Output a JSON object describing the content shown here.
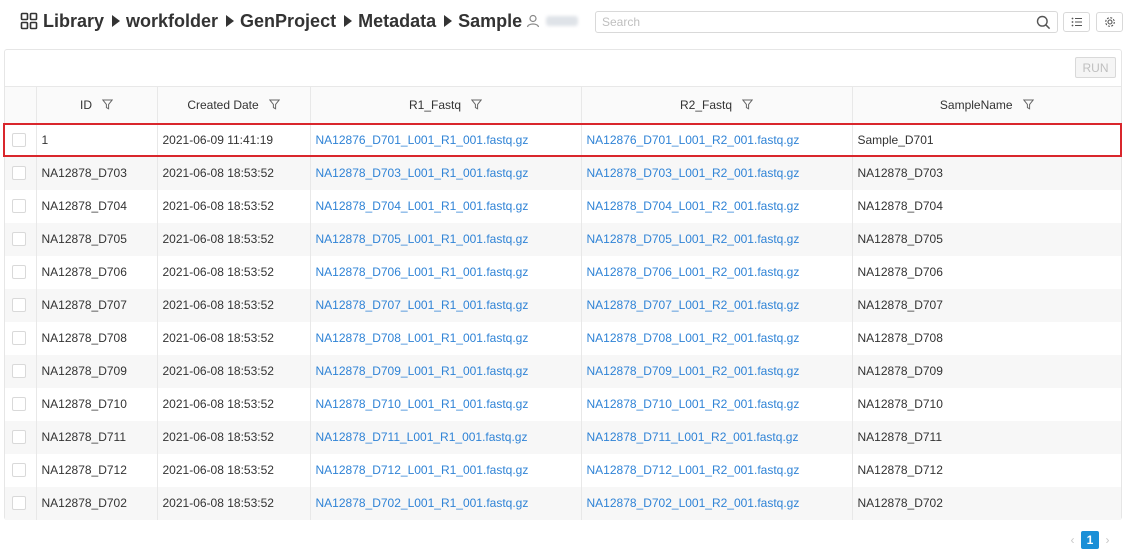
{
  "breadcrumb": {
    "items": [
      "Library",
      "workfolder",
      "GenProject",
      "Metadata",
      "Sample"
    ]
  },
  "icons": {
    "home": "grid-icon",
    "user": "user-icon",
    "search": "search-icon",
    "list": "list-icon",
    "settings": "gear-icon",
    "filter": "filter-icon"
  },
  "search": {
    "placeholder": "Search",
    "value": ""
  },
  "toolbar": {
    "run_label": "RUN"
  },
  "table": {
    "columns": [
      "ID",
      "Created Date",
      "R1_Fastq",
      "R2_Fastq",
      "SampleName"
    ],
    "rows": [
      [
        "1",
        "2021-06-09 11:41:19",
        "NA12876_D701_L001_R1_001.fastq.gz",
        "NA12876_D701_L001_R2_001.fastq.gz",
        "Sample_D701"
      ],
      [
        "NA12878_D703",
        "2021-06-08 18:53:52",
        "NA12878_D703_L001_R1_001.fastq.gz",
        "NA12878_D703_L001_R2_001.fastq.gz",
        "NA12878_D703"
      ],
      [
        "NA12878_D704",
        "2021-06-08 18:53:52",
        "NA12878_D704_L001_R1_001.fastq.gz",
        "NA12878_D704_L001_R2_001.fastq.gz",
        "NA12878_D704"
      ],
      [
        "NA12878_D705",
        "2021-06-08 18:53:52",
        "NA12878_D705_L001_R1_001.fastq.gz",
        "NA12878_D705_L001_R2_001.fastq.gz",
        "NA12878_D705"
      ],
      [
        "NA12878_D706",
        "2021-06-08 18:53:52",
        "NA12878_D706_L001_R1_001.fastq.gz",
        "NA12878_D706_L001_R2_001.fastq.gz",
        "NA12878_D706"
      ],
      [
        "NA12878_D707",
        "2021-06-08 18:53:52",
        "NA12878_D707_L001_R1_001.fastq.gz",
        "NA12878_D707_L001_R2_001.fastq.gz",
        "NA12878_D707"
      ],
      [
        "NA12878_D708",
        "2021-06-08 18:53:52",
        "NA12878_D708_L001_R1_001.fastq.gz",
        "NA12878_D708_L001_R2_001.fastq.gz",
        "NA12878_D708"
      ],
      [
        "NA12878_D709",
        "2021-06-08 18:53:52",
        "NA12878_D709_L001_R1_001.fastq.gz",
        "NA12878_D709_L001_R2_001.fastq.gz",
        "NA12878_D709"
      ],
      [
        "NA12878_D710",
        "2021-06-08 18:53:52",
        "NA12878_D710_L001_R1_001.fastq.gz",
        "NA12878_D710_L001_R2_001.fastq.gz",
        "NA12878_D710"
      ],
      [
        "NA12878_D711",
        "2021-06-08 18:53:52",
        "NA12878_D711_L001_R1_001.fastq.gz",
        "NA12878_D711_L001_R2_001.fastq.gz",
        "NA12878_D711"
      ],
      [
        "NA12878_D712",
        "2021-06-08 18:53:52",
        "NA12878_D712_L001_R1_001.fastq.gz",
        "NA12878_D712_L001_R2_001.fastq.gz",
        "NA12878_D712"
      ],
      [
        "NA12878_D702",
        "2021-06-08 18:53:52",
        "NA12878_D702_L001_R1_001.fastq.gz",
        "NA12878_D702_L001_R2_001.fastq.gz",
        "NA12878_D702"
      ]
    ]
  },
  "pagination": {
    "prev": "‹",
    "current_page": "1",
    "next": "›"
  },
  "colors": {
    "link": "#2f83d6",
    "highlight": "#d9262c",
    "page_active": "#1a8fd7"
  }
}
